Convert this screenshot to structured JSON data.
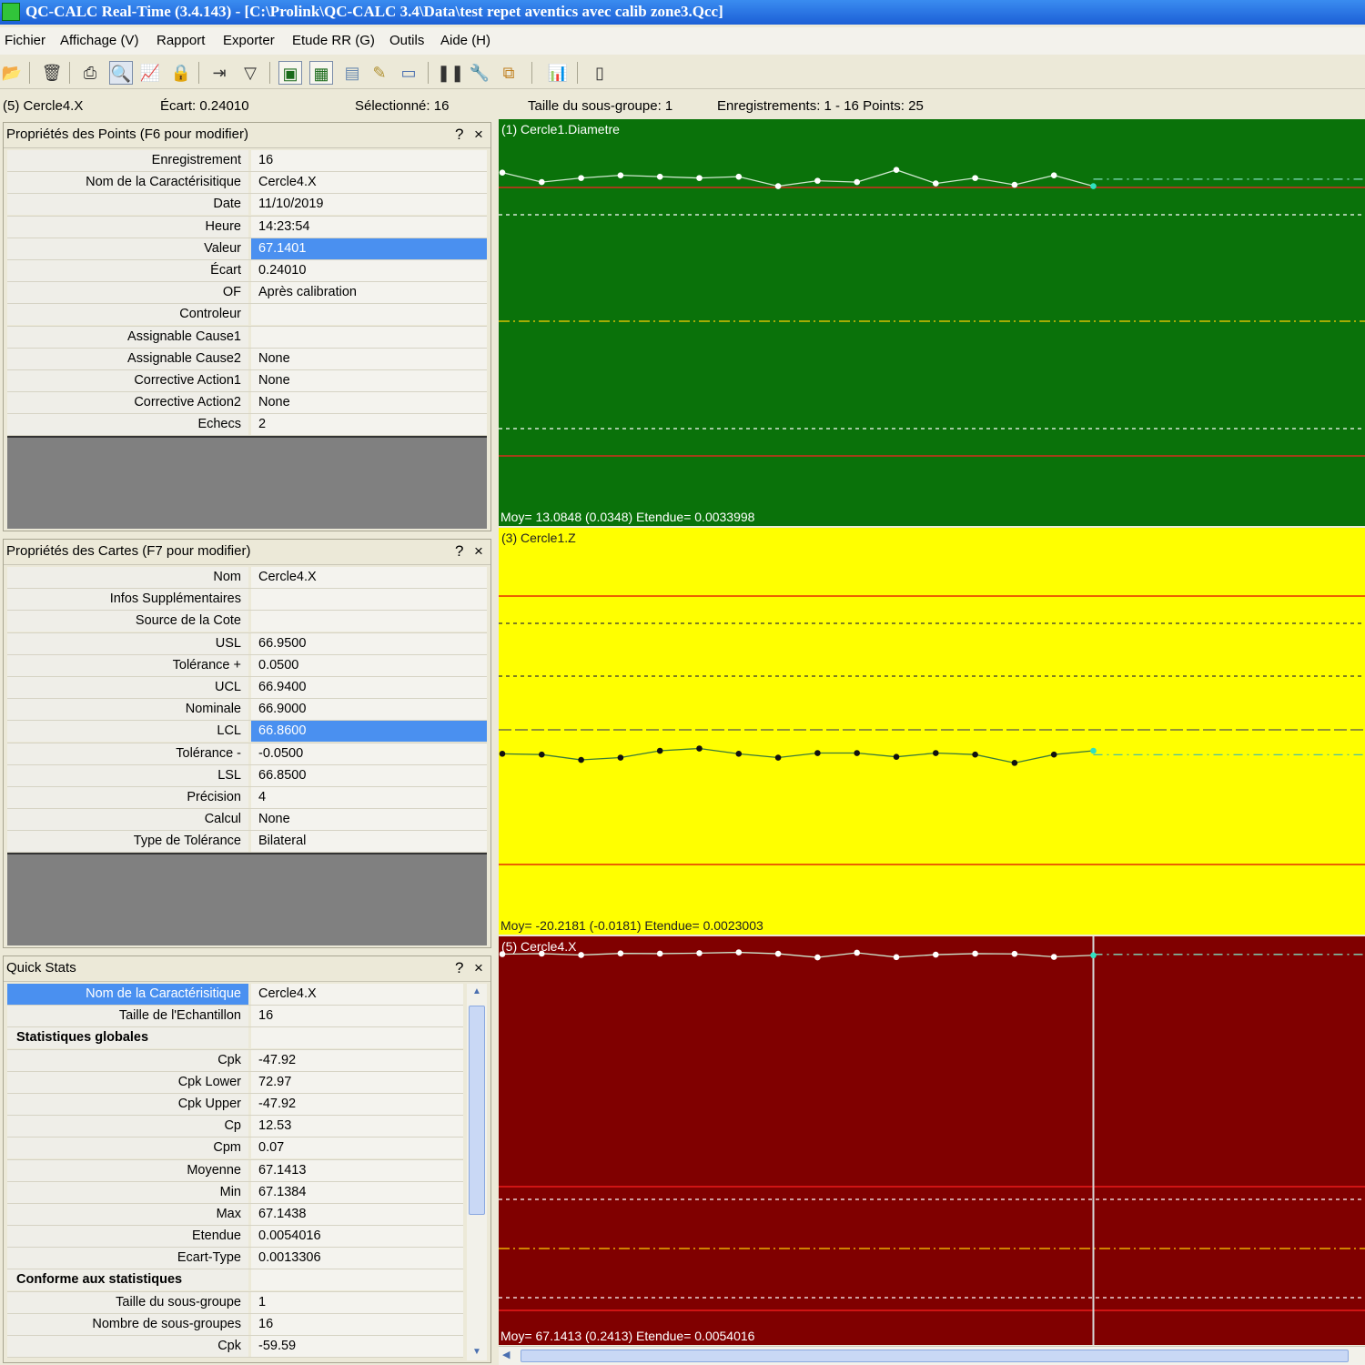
{
  "window": {
    "title": "QC-CALC Real-Time (3.4.143)  - [C:\\Prolink\\QC-CALC 3.4\\Data\\test repet aventics avec calib zone3.Qcc]"
  },
  "menu": [
    "Fichier",
    "Affichage (V)",
    "Rapport",
    "Exporter",
    "Etude RR (G)",
    "Outils",
    "Aide (H)"
  ],
  "status": {
    "feature": "(5) Cercle4.X",
    "ecart": "Écart: 0.24010",
    "selected": "Sélectionné: 16",
    "subgroup": "Taille du sous-groupe: 1",
    "records": "Enregistrements: 1 - 16  Points: 25"
  },
  "points_panel": {
    "title": "Propriétés des Points (F6 pour modifier)",
    "help": "?",
    "close": "×",
    "rows": [
      {
        "label": "Enregistrement",
        "value": "16"
      },
      {
        "label": "Nom de la Caractérisitique",
        "value": "Cercle4.X"
      },
      {
        "label": "Date",
        "value": "11/10/2019"
      },
      {
        "label": "Heure",
        "value": "14:23:54"
      },
      {
        "label": "Valeur",
        "value": "67.1401"
      },
      {
        "label": "Écart",
        "value": "0.24010"
      },
      {
        "label": "OF",
        "value": "Après calibration"
      },
      {
        "label": "Controleur",
        "value": ""
      },
      {
        "label": "Assignable Cause1",
        "value": ""
      },
      {
        "label": "Assignable Cause2",
        "value": "None"
      },
      {
        "label": "Corrective Action1",
        "value": "None"
      },
      {
        "label": "Corrective Action2",
        "value": "None"
      },
      {
        "label": "Echecs",
        "value": "2"
      }
    ]
  },
  "cards_panel": {
    "title": "Propriétés des Cartes (F7 pour modifier)",
    "help": "?",
    "close": "×",
    "rows": [
      {
        "label": "Nom",
        "value": "Cercle4.X"
      },
      {
        "label": "Infos Supplémentaires",
        "value": ""
      },
      {
        "label": "Source de la Cote",
        "value": ""
      },
      {
        "label": "USL",
        "value": "66.9500"
      },
      {
        "label": "Tolérance +",
        "value": "0.0500"
      },
      {
        "label": "UCL",
        "value": "66.9400"
      },
      {
        "label": "Nominale",
        "value": "66.9000"
      },
      {
        "label": "LCL",
        "value": "66.8600"
      },
      {
        "label": "Tolérance -",
        "value": "-0.0500"
      },
      {
        "label": "LSL",
        "value": "66.8500"
      },
      {
        "label": "Précision",
        "value": "4"
      },
      {
        "label": "Calcul",
        "value": "None"
      },
      {
        "label": "Type de Tolérance",
        "value": "Bilateral"
      }
    ]
  },
  "quick_stats": {
    "title": "Quick Stats",
    "help": "?",
    "close": "×",
    "rows": [
      {
        "label": "Nom de la Caractérisitique",
        "value": "Cercle4.X"
      },
      {
        "label": "Taille de l'Echantillon",
        "value": "16"
      },
      {
        "label": "Statistiques globales",
        "value": "",
        "group": true
      },
      {
        "label": "Cpk",
        "value": "-47.92"
      },
      {
        "label": "Cpk Lower",
        "value": "72.97"
      },
      {
        "label": "Cpk Upper",
        "value": "-47.92"
      },
      {
        "label": "Cp",
        "value": "12.53"
      },
      {
        "label": "Cpm",
        "value": "0.07"
      },
      {
        "label": "Moyenne",
        "value": "67.1413"
      },
      {
        "label": "Min",
        "value": "67.1384"
      },
      {
        "label": "Max",
        "value": "67.1438"
      },
      {
        "label": "Etendue",
        "value": "0.0054016"
      },
      {
        "label": "Ecart-Type",
        "value": "0.0013306"
      },
      {
        "label": "Conforme aux statistiques",
        "value": "",
        "group": true
      },
      {
        "label": "Taille du sous-groupe",
        "value": "1"
      },
      {
        "label": "Nombre de sous-groupes",
        "value": "16"
      },
      {
        "label": "Cpk",
        "value": "-59.59"
      }
    ]
  },
  "chart_data": [
    {
      "type": "line",
      "title": "(1) Cercle1.Diametre",
      "footer": "Moy= 13.0848  (0.0348) Etendue= 0.0033998",
      "background": "#0a720a",
      "point_color": "#ffffff",
      "line_color": "#cfe8cf",
      "x": [
        1,
        2,
        3,
        4,
        5,
        6,
        7,
        8,
        9,
        10,
        11,
        12,
        13,
        14,
        15,
        16
      ],
      "values": [
        13.085,
        13.0843,
        13.0846,
        13.0848,
        13.0847,
        13.0846,
        13.0847,
        13.084,
        13.0844,
        13.0843,
        13.0852,
        13.0842,
        13.0846,
        13.0841,
        13.0848,
        13.084
      ],
      "ylim": [
        13.06,
        13.088
      ]
    },
    {
      "type": "line",
      "title": "(3) Cercle1.Z",
      "footer": "Moy= -20.2181  (-0.0181) Etendue= 0.0023003",
      "background": "#ffff00",
      "point_color": "#111111",
      "line_color": "#3a7a3a",
      "x": [
        1,
        2,
        3,
        4,
        5,
        6,
        7,
        8,
        9,
        10,
        11,
        12,
        13,
        14,
        15,
        16
      ],
      "values": [
        -20.2181,
        -20.2182,
        -20.2189,
        -20.2186,
        -20.2177,
        -20.2174,
        -20.2181,
        -20.2186,
        -20.218,
        -20.218,
        -20.2185,
        -20.218,
        -20.2182,
        -20.2193,
        -20.2182,
        -20.2177
      ],
      "ylim": [
        -20.24,
        -20.19
      ]
    },
    {
      "type": "line",
      "title": "(5) Cercle4.X",
      "footer": "Moy= 67.1413  (0.2413) Etendue= 0.0054016",
      "background": "#800000",
      "point_color": "#ffffff",
      "line_color": "#cfe8cf",
      "x": [
        1,
        2,
        3,
        4,
        5,
        6,
        7,
        8,
        9,
        10,
        11,
        12,
        13,
        14,
        15,
        16
      ],
      "values": [
        67.141,
        67.1414,
        67.1403,
        67.1416,
        67.1414,
        67.1418,
        67.1424,
        67.1413,
        67.1384,
        67.1421,
        67.1386,
        67.1406,
        67.1414,
        67.1412,
        67.1388,
        67.1401
      ],
      "ylim": [
        66.84,
        67.145
      ]
    }
  ]
}
